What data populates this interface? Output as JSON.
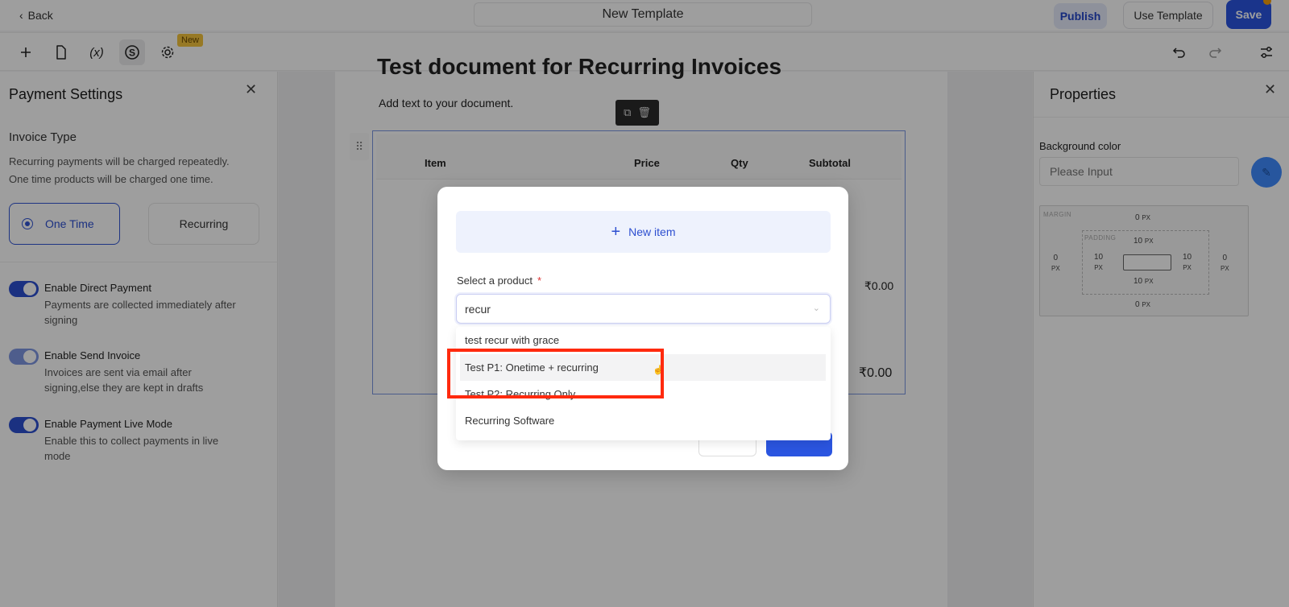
{
  "header": {
    "back_label": "Back",
    "title": "New Template",
    "publish_label": "Publish",
    "use_template_label": "Use Template",
    "save_label": "Save"
  },
  "toolbar": {
    "icons": [
      "plus-icon",
      "document-icon",
      "variable-icon",
      "payment-icon",
      "gear-icon"
    ],
    "variable_glyph": "(x)",
    "new_badge": "New",
    "right_icons": [
      "undo-icon",
      "redo-icon",
      "settings-sliders-icon"
    ]
  },
  "payment_settings": {
    "title": "Payment Settings",
    "section_title": "Invoice Type",
    "description_line1": "Recurring payments will be charged repeatedly.",
    "description_line2": "One time products will be charged one time.",
    "invoice_types": [
      {
        "label": "One Time",
        "selected": true
      },
      {
        "label": "Recurring",
        "selected": false
      }
    ],
    "toggles": [
      {
        "label": "Enable Direct Payment",
        "description": "Payments are collected immediately after signing",
        "on": true
      },
      {
        "label": "Enable Send Invoice",
        "description": "Invoices are sent via email after signing,else they are kept in drafts",
        "on": true
      },
      {
        "label": "Enable Payment Live Mode",
        "description": "Enable this to collect payments in live mode",
        "on": true
      }
    ]
  },
  "document": {
    "title": "Test document for Recurring Invoices",
    "subtitle": "Add text to your document.",
    "table_headers": [
      "Item",
      "Price",
      "Qty",
      "Subtotal"
    ],
    "row_amount": "₹0.00",
    "total_amount": "₹0.00"
  },
  "properties": {
    "title": "Properties",
    "background_color_label": "Background color",
    "background_color_placeholder": "Please Input",
    "margin_label": "MARGIN",
    "padding_label": "PADDING",
    "unit": "PX",
    "margin": {
      "top": "0",
      "right": "0",
      "bottom": "0",
      "left": "0"
    },
    "padding": {
      "top": "10",
      "right": "10",
      "bottom": "10",
      "left": "10"
    }
  },
  "modal": {
    "new_item_label": "New item",
    "select_label": "Select a product",
    "required_mark": "*",
    "search_value": "recur",
    "options": [
      "test recur with grace",
      "Test P1: Onetime + recurring",
      "Test P2: Recurring Only",
      "Recurring Software"
    ],
    "hovered_option_index": 1
  },
  "colors": {
    "accent": "#2b55e0",
    "highlight": "#ff2a0e",
    "new_badge": "#f4c33c"
  }
}
